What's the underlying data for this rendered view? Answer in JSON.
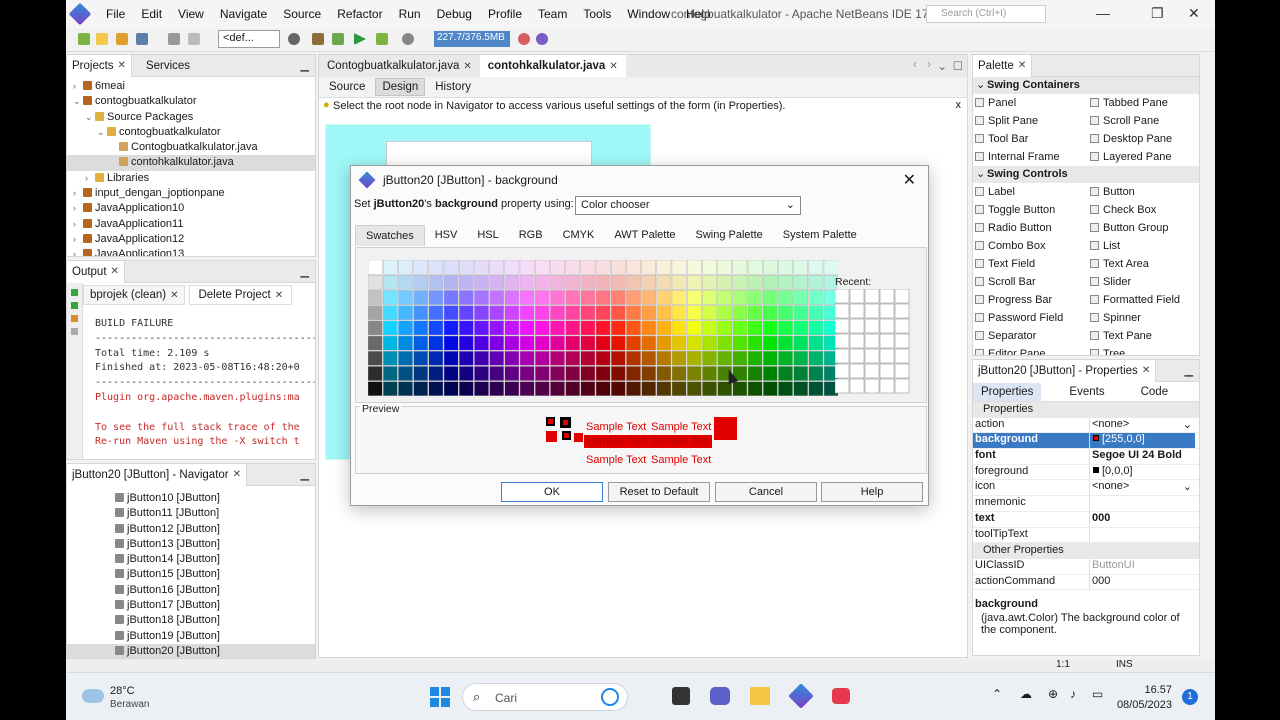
{
  "menubar": {
    "items": [
      "File",
      "Edit",
      "View",
      "Navigate",
      "Source",
      "Refactor",
      "Run",
      "Debug",
      "Profile",
      "Team",
      "Tools",
      "Window",
      "Help"
    ],
    "title": "contogbuatkalkulator - Apache NetBeans IDE 17",
    "search_placeholder": "Search (Ctrl+I)"
  },
  "toolbar": {
    "config_select": "<def...",
    "memory": "227.7/376.5MB"
  },
  "projects": {
    "tabs": [
      "Projects",
      "Services"
    ],
    "rows": [
      {
        "label": "6meai",
        "indent": 0,
        "fold": "›"
      },
      {
        "label": "contogbuatkalkulator",
        "indent": 0,
        "fold": "⌄"
      },
      {
        "label": "Source Packages",
        "indent": 1,
        "fold": "⌄"
      },
      {
        "label": "contogbuatkalkulator",
        "indent": 2,
        "fold": "⌄"
      },
      {
        "label": "Contogbuatkalkulator.java",
        "indent": 3,
        "fold": ""
      },
      {
        "label": "contohkalkulator.java",
        "indent": 3,
        "fold": "",
        "selected": true
      },
      {
        "label": "Libraries",
        "indent": 1,
        "fold": "›"
      },
      {
        "label": "input_dengan_joptionpane",
        "indent": 0,
        "fold": "›"
      },
      {
        "label": "JavaApplication10",
        "indent": 0,
        "fold": "›"
      },
      {
        "label": "JavaApplication11",
        "indent": 0,
        "fold": "›"
      },
      {
        "label": "JavaApplication12",
        "indent": 0,
        "fold": "›"
      },
      {
        "label": "JavaApplication13",
        "indent": 0,
        "fold": "›"
      }
    ]
  },
  "output": {
    "title": "Output",
    "tabs": [
      "bprojek (clean)",
      "Delete Project"
    ],
    "lines": [
      {
        "text": "BUILD FAILURE",
        "color": "#333333"
      },
      {
        "text": "------------------------------------------------",
        "color": "#333333"
      },
      {
        "text": "Total time:  2.109 s",
        "color": "#333333"
      },
      {
        "text": "Finished at: 2023-05-08T16:48:20+0",
        "color": "#333333"
      },
      {
        "text": "------------------------------------------------",
        "color": "#333333"
      },
      {
        "text": "Plugin org.apache.maven.plugins:ma",
        "color": "#c62828"
      },
      {
        "text": "",
        "color": "#333333"
      },
      {
        "text": "To see the full stack trace of the",
        "color": "#c62828"
      },
      {
        "text": "Re-run Maven using the -X switch t",
        "color": "#c62828"
      }
    ]
  },
  "navigator": {
    "title": "jButton20 [JButton] - Navigator",
    "rows": [
      "jButton10 [JButton]",
      "jButton11 [JButton]",
      "jButton12 [JButton]",
      "jButton13 [JButton]",
      "jButton14 [JButton]",
      "jButton15 [JButton]",
      "jButton16 [JButton]",
      "jButton17 [JButton]",
      "jButton18 [JButton]",
      "jButton19 [JButton]",
      "jButton20 [JButton]"
    ]
  },
  "editor": {
    "tabs": [
      "Contogbuatkalkulator.java",
      "contohkalkulator.java"
    ],
    "subtabs": [
      "Source",
      "Design",
      "History"
    ],
    "hint": "Select the root node in Navigator to access various useful settings of the form (in Properties)."
  },
  "dialog": {
    "title": "jButton20 [JButton] - background",
    "set_prefix": "Set ",
    "set_bold1": "jButton20",
    "set_mid": "'s ",
    "set_bold2": "background",
    "set_suffix": " property using:",
    "method": "Color chooser",
    "tabs": [
      "Swatches",
      "HSV",
      "HSL",
      "RGB",
      "CMYK",
      "AWT Palette",
      "Swing Palette",
      "System Palette"
    ],
    "recent_label": "Recent:",
    "preview_label": "Preview",
    "sample_text": "Sample Text",
    "buttons": {
      "ok": "OK",
      "reset": "Reset to Default",
      "cancel": "Cancel",
      "help": "Help"
    }
  },
  "palette": {
    "title": "Palette",
    "sections": [
      {
        "name": "Swing Containers",
        "items": [
          "Panel",
          "Tabbed Pane",
          "Split Pane",
          "Scroll Pane",
          "Tool Bar",
          "Desktop Pane",
          "Internal Frame",
          "Layered Pane"
        ]
      },
      {
        "name": "Swing Controls",
        "items": [
          "Label",
          "Button",
          "Toggle Button",
          "Check Box",
          "Radio Button",
          "Button Group",
          "Combo Box",
          "List",
          "Text Field",
          "Text Area",
          "Scroll Bar",
          "Slider",
          "Progress Bar",
          "Formatted Field",
          "Password Field",
          "Spinner",
          "Separator",
          "Text Pane",
          "Editor Pane",
          "Tree"
        ]
      }
    ]
  },
  "properties": {
    "title": "jButton20 [JButton] - Properties",
    "tabs": [
      "Properties",
      "Events",
      "Code"
    ],
    "group1": "Properties",
    "rows": [
      {
        "name": "action",
        "value": "<none>",
        "bold": false
      },
      {
        "name": "background",
        "value": "[255,0,0]",
        "bold": true,
        "selected": true
      },
      {
        "name": "font",
        "value": "Segoe UI 24 Bold",
        "bold": true
      },
      {
        "name": "foreground",
        "value": "[0,0,0]",
        "bold": false
      },
      {
        "name": "icon",
        "value": "<none>",
        "bold": false
      },
      {
        "name": "mnemonic",
        "value": "",
        "bold": false
      },
      {
        "name": "text",
        "value": "000",
        "bold": true
      },
      {
        "name": "toolTipText",
        "value": "",
        "bold": false
      }
    ],
    "group2": "Other Properties",
    "rows2": [
      {
        "name": "UIClassID",
        "value": "ButtonUI"
      },
      {
        "name": "actionCommand",
        "value": "000"
      }
    ],
    "desc_title": "background",
    "desc_text": "(java.awt.Color) The background color of the component."
  },
  "statusbar": {
    "position": "1:1",
    "mode": "INS"
  },
  "taskbar": {
    "temp": "28°C",
    "weather": "Berawan",
    "search": "Cari",
    "time": "16.57",
    "date": "08/05/2023",
    "notif": "1"
  },
  "colors": {
    "accent": "#3a79c3",
    "selected_red": "#e00000"
  }
}
